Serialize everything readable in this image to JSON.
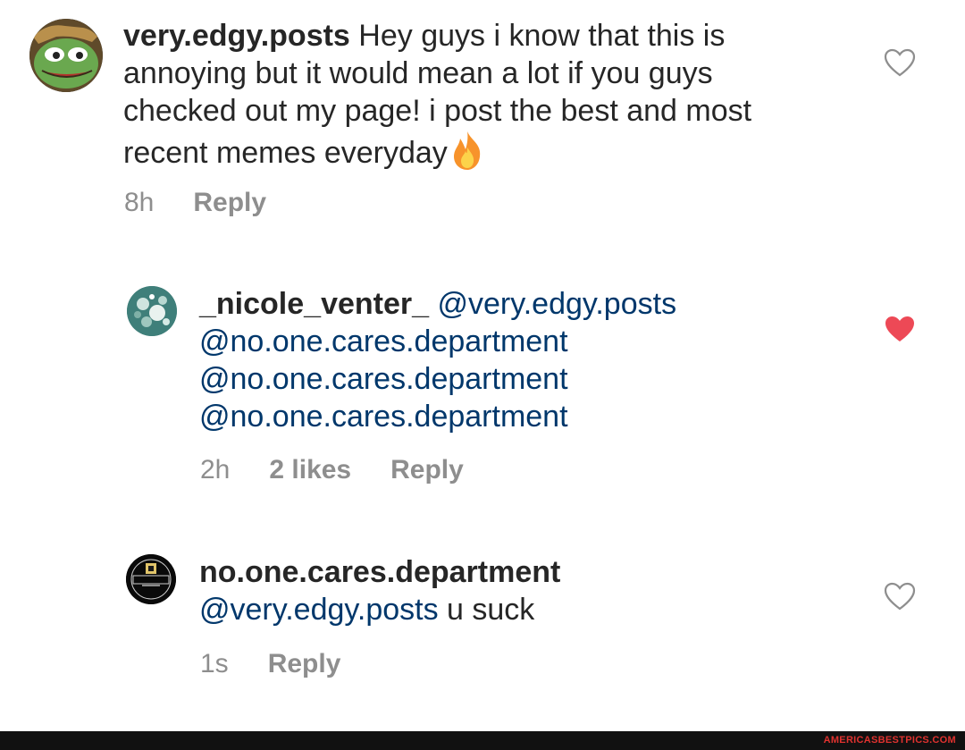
{
  "comments": [
    {
      "username": "very.edgy.posts",
      "text_line1": " Hey guys i know that this is",
      "text_line2": "annoying but it would mean a lot if you guys",
      "text_line3": "checked out my page! i post the best and most",
      "text_line4": "recent memes everyday",
      "emoji": "fire",
      "time": "8h",
      "reply_label": "Reply",
      "liked": false
    },
    {
      "username": "_nicole_venter_",
      "mention1": "@very.edgy.posts",
      "mention2": "@no.one.cares.department",
      "mention3": "@no.one.cares.department",
      "mention4": "@no.one.cares.department",
      "time": "2h",
      "likes": "2 likes",
      "reply_label": "Reply",
      "liked": true
    },
    {
      "username": "no.one.cares.department",
      "mention": "@very.edgy.posts",
      "text": " u suck",
      "time": "1s",
      "reply_label": "Reply",
      "liked": false
    }
  ],
  "colors": {
    "mention": "#00376b",
    "liked_heart": "#ed4956",
    "meta": "#8e8e8e"
  },
  "footer": {
    "watermark": "AMERICASBESTPICS.COM"
  }
}
